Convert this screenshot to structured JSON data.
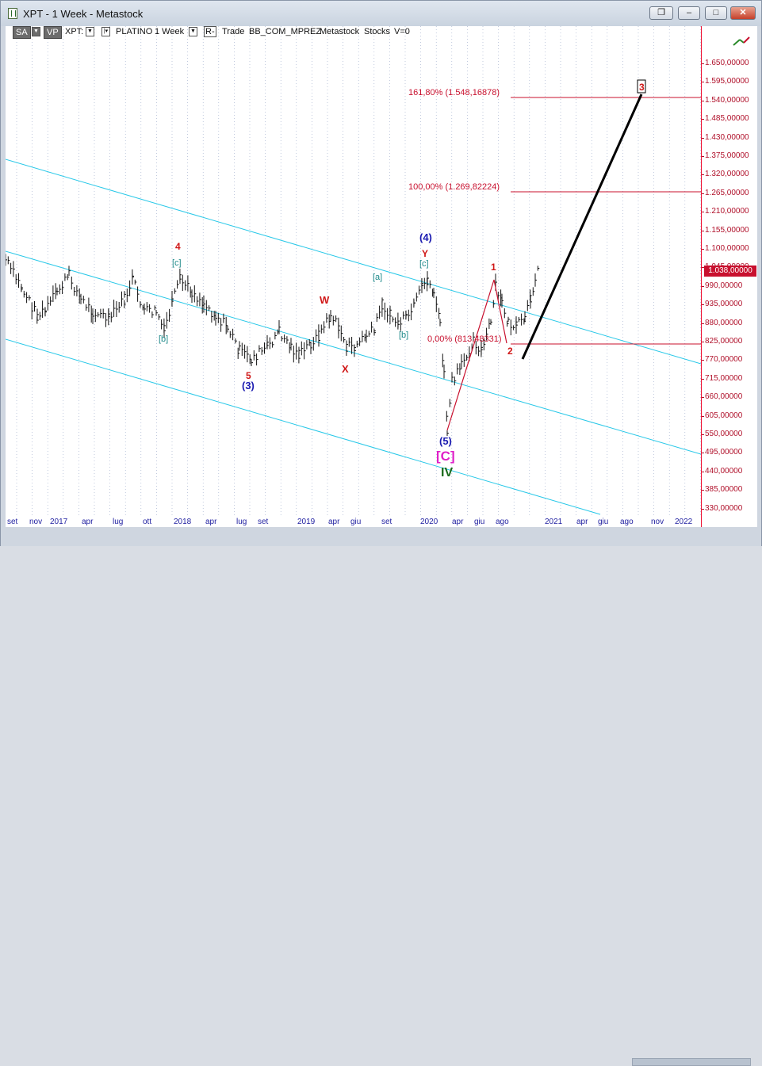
{
  "window": {
    "title": "XPT - 1 Week - Metastock",
    "buttons": {
      "restore_label": "❐",
      "minimize_label": "–",
      "maximize_label": "□",
      "close_label": "✕"
    }
  },
  "toolbar": {
    "sa_label": "SA",
    "vp_label": "VP",
    "symbol": "XPT:",
    "name": "PLATINO",
    "interval": "1 Week",
    "r_label": "R-",
    "mode": "Trade",
    "indicator": "BB_COM_MPREZ",
    "source": "Metastock",
    "category": "Stocks",
    "volume": "V=0"
  },
  "price_axis": {
    "ticks": [
      "1.650,00000",
      "1.595,00000",
      "1.540,00000",
      "1.485,00000",
      "1.430,00000",
      "1.375,00000",
      "1.320,00000",
      "1.265,00000",
      "1.210,00000",
      "1.155,00000",
      "1.100,00000",
      "1.045,00000",
      "990,00000",
      "935,00000",
      "880,00000",
      "825,00000",
      "770,00000",
      "715,00000",
      "660,00000",
      "605,00000",
      "550,00000",
      "495,00000",
      "440,00000",
      "385,00000",
      "330,00000"
    ],
    "current_price": "1.038,00000"
  },
  "time_axis": {
    "labels": [
      "set",
      "nov",
      "2017",
      "apr",
      "lug",
      "ott",
      "2018",
      "apr",
      "lug",
      "set",
      "2019",
      "apr",
      "giu",
      "set",
      "2020",
      "apr",
      "giu",
      "ago",
      "2021",
      "apr",
      "giu",
      "ago",
      "nov",
      "2022"
    ]
  },
  "fib_levels": [
    {
      "label": "161,80% (1.548,16878)",
      "price": 1548.17
    },
    {
      "label": "100,00% (1.269,82224)",
      "price": 1269.82
    },
    {
      "label": "0,00% (813,48331)",
      "price": 813.48
    }
  ],
  "wave_labels": [
    {
      "text": "4",
      "color": "#d01818"
    },
    {
      "text": "[c]",
      "color": "#1f8a8a"
    },
    {
      "text": "[b]",
      "color": "#1f8a8a"
    },
    {
      "text": "5",
      "color": "#d01818"
    },
    {
      "text": "(3)",
      "color": "#1a1ab0"
    },
    {
      "text": "W",
      "color": "#d01818"
    },
    {
      "text": "X",
      "color": "#d01818"
    },
    {
      "text": "[a]",
      "color": "#1f8a8a"
    },
    {
      "text": "[b]",
      "color": "#1f8a8a"
    },
    {
      "text": "(4)",
      "color": "#1a1ab0"
    },
    {
      "text": "Y",
      "color": "#d01818"
    },
    {
      "text": "[c]",
      "color": "#1f8a8a"
    },
    {
      "text": "(5)",
      "color": "#1a1ab0"
    },
    {
      "text": "[C]",
      "color": "#e020c8"
    },
    {
      "text": "IV",
      "color": "#1a6a1a"
    },
    {
      "text": "1",
      "color": "#d01818"
    },
    {
      "text": "2",
      "color": "#d01818"
    },
    {
      "text": "3",
      "color": "#d01818"
    }
  ],
  "colors": {
    "channel": "#28c8e8",
    "fib": "#c8102e",
    "price_bars": "#111111",
    "projection": "#000000"
  }
}
